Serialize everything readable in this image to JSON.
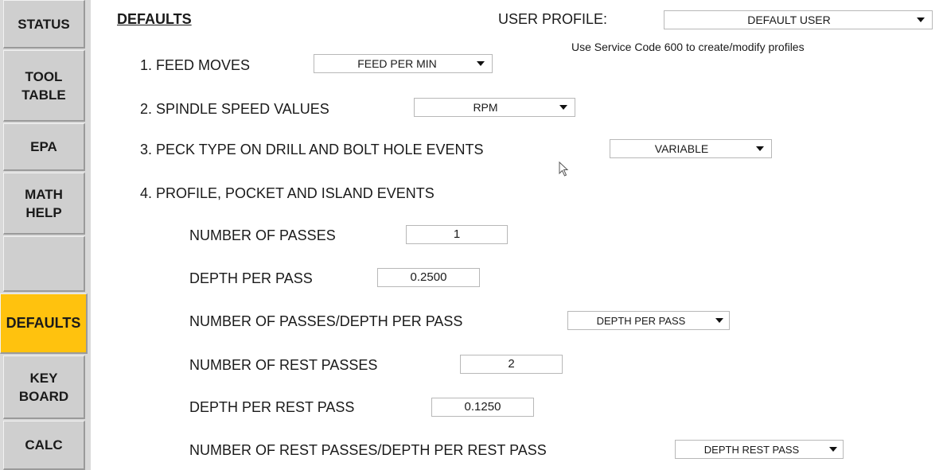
{
  "sidebar": {
    "items": [
      {
        "label": "STATUS"
      },
      {
        "label": "TOOL\nTABLE"
      },
      {
        "label": "EPA"
      },
      {
        "label": "MATH\nHELP"
      },
      {
        "label": ""
      },
      {
        "label": "DEFAULTS",
        "active": true
      },
      {
        "label": "KEY\nBOARD"
      },
      {
        "label": "CALC"
      }
    ],
    "active_color": "#ffc20e"
  },
  "header": {
    "title": "DEFAULTS",
    "user_profile_label": "USER PROFILE:",
    "user_profile_value": "DEFAULT USER",
    "hint": "Use Service Code 600 to create/modify profiles"
  },
  "settings": {
    "feed_moves": {
      "label": "1.  FEED MOVES",
      "value": "FEED PER MIN"
    },
    "spindle_speed": {
      "label": "2.  SPINDLE SPEED VALUES",
      "value": "RPM"
    },
    "peck_type": {
      "label": "3.  PECK TYPE ON DRILL AND BOLT HOLE EVENTS",
      "value": "VARIABLE"
    },
    "profile_events": {
      "label": "4.  PROFILE, POCKET AND ISLAND EVENTS",
      "number_of_passes": {
        "label": "NUMBER OF PASSES",
        "value": "1"
      },
      "depth_per_pass": {
        "label": "DEPTH PER PASS",
        "value": "0.2500"
      },
      "passes_or_depth": {
        "label": "NUMBER OF PASSES/DEPTH PER PASS",
        "value": "DEPTH PER PASS"
      },
      "number_of_rest_passes": {
        "label": "NUMBER OF REST PASSES",
        "value": "2"
      },
      "depth_per_rest_pass": {
        "label": "DEPTH PER REST PASS",
        "value": "0.1250"
      },
      "rest_passes_or_depth": {
        "label": "NUMBER OF REST PASSES/DEPTH PER REST PASS",
        "value": "DEPTH REST PASS"
      }
    }
  }
}
